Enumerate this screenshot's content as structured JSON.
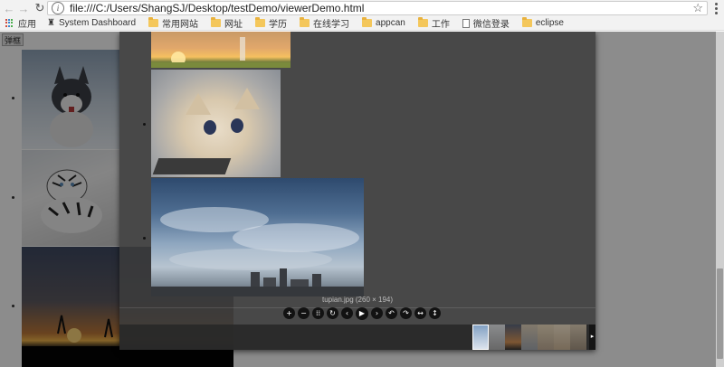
{
  "browser": {
    "url": "file:///C:/Users/ShangSJ/Desktop/testDemo/viewerDemo.html",
    "bookmarks": [
      {
        "label": "应用",
        "icon": "apps-grid-icon"
      },
      {
        "label": "System Dashboard",
        "icon": "dashboard-icon"
      },
      {
        "label": "常用网站",
        "icon": "folder-icon"
      },
      {
        "label": "网址",
        "icon": "folder-icon"
      },
      {
        "label": "学历",
        "icon": "folder-icon"
      },
      {
        "label": "在线学习",
        "icon": "folder-icon"
      },
      {
        "label": "appcan",
        "icon": "folder-icon"
      },
      {
        "label": "工作",
        "icon": "folder-icon"
      },
      {
        "label": "微信登录",
        "icon": "page-icon"
      },
      {
        "label": "eclipse",
        "icon": "folder-icon"
      }
    ]
  },
  "page": {
    "popup_button_label": "弹框"
  },
  "viewer": {
    "caption": "tupian.jpg (260 × 194)",
    "toolbar": [
      {
        "name": "zoom-in",
        "glyph": "+"
      },
      {
        "name": "zoom-out",
        "glyph": "−"
      },
      {
        "name": "one-to-one",
        "glyph": "⁞⁞"
      },
      {
        "name": "reset",
        "glyph": "↻"
      },
      {
        "name": "prev",
        "glyph": "‹"
      },
      {
        "name": "play",
        "glyph": "▶"
      },
      {
        "name": "next",
        "glyph": "›"
      },
      {
        "name": "rotate-left",
        "glyph": "↶"
      },
      {
        "name": "rotate-right",
        "glyph": "↷"
      },
      {
        "name": "flip-horizontal",
        "glyph": "↔"
      },
      {
        "name": "flip-vertical",
        "glyph": "↕"
      }
    ],
    "thumbnail_count": 7,
    "active_thumbnail_index": 0
  }
}
